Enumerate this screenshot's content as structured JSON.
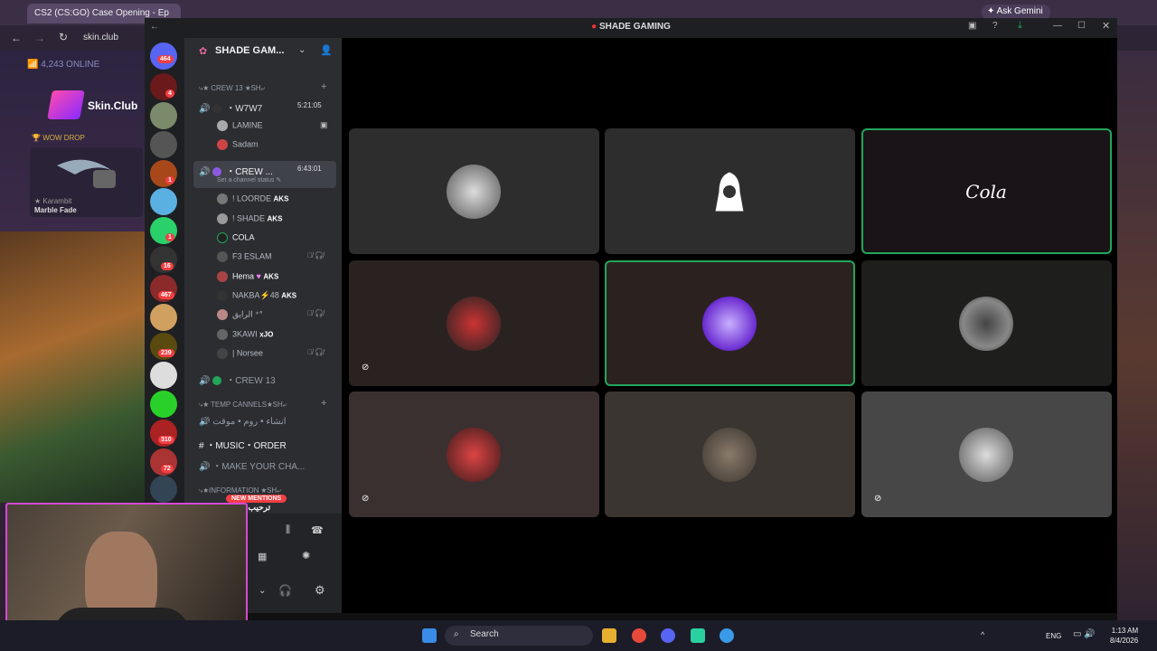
{
  "browser": {
    "tab_title": "CS2 (CS:GO) Case Opening - Ep",
    "address": "skin.club",
    "gemini": "Ask Gemini"
  },
  "site": {
    "online_count": "4,243",
    "online_label": "ONLINE",
    "logo": "Skin.Club",
    "wow_drop": "WOW DROP",
    "item_name": "★ Karambit",
    "item_skin": "Marble Fade"
  },
  "discord": {
    "window_title": "SHADE GAMING",
    "server_name": "SHADE GAM...",
    "guild_badges": [
      "464",
      "4",
      "1",
      "1",
      "16",
      "467",
      "239",
      "310",
      "72"
    ],
    "categories": {
      "crew13": "⤷★ CREW 13 ★SH⤶",
      "temp": "⤷★ TEMP CANNELS★SH⤶",
      "info": "⤷★INFORMATION ★SH⤶"
    },
    "voice1": {
      "name": "・W7W7",
      "time": "5:21:05"
    },
    "voice1_members": [
      "LAMINE",
      "Sadam"
    ],
    "voice2": {
      "name": "・CREW ...",
      "time": "6:43:01",
      "status": "Set a channel status"
    },
    "voice2_members": [
      {
        "name": "! LOORDE",
        "tag": "AKS"
      },
      {
        "name": "! SHADE",
        "tag": "AKS"
      },
      {
        "name": "COLA",
        "tag": ""
      },
      {
        "name": "F3 ESLAM",
        "tag": ""
      },
      {
        "name": "Hema",
        "tag": "AKS"
      },
      {
        "name": "NAKBA⚡48",
        "tag": "AKS"
      },
      {
        "name": "الرايق ⁺°",
        "tag": ""
      },
      {
        "name": "3KAWI",
        "tag": "xJO"
      },
      {
        "name": "| Norsee",
        "tag": ""
      }
    ],
    "voice3": "・CREW 13",
    "temp_channels": [
      "انشاء • روم • موقت",
      "・MUSIC・ORDER",
      "・MAKE YOUR CHA..."
    ],
    "welcome": "WELCOME | ترحيب",
    "new_mentions": "NEW MENTIONS",
    "cola_text": "Cola"
  },
  "taskbar": {
    "search": "Search",
    "lang": "ENG",
    "time": "1:13 AM",
    "date": "8/4/2026"
  }
}
